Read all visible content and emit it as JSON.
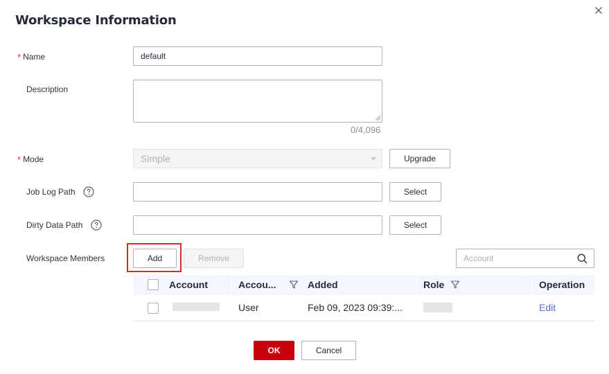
{
  "dialog": {
    "title": "Workspace Information"
  },
  "form": {
    "name_label": "Name",
    "name_value": "default",
    "description_label": "Description",
    "description_counter": "0/4,096",
    "mode_label": "Mode",
    "mode_value": "Simple",
    "upgrade_label": "Upgrade",
    "job_log_path_label": "Job Log Path",
    "dirty_data_path_label": "Dirty Data Path",
    "select_label": "Select",
    "workspace_members_label": "Workspace Members"
  },
  "members": {
    "add_label": "Add",
    "remove_label": "Remove",
    "search_placeholder": "Account",
    "columns": [
      "Account",
      "Accou...",
      "Added",
      "Role",
      "Operation"
    ],
    "rows": [
      {
        "account_type": "User",
        "added": "Feb 09, 2023 09:39:...",
        "operation": "Edit"
      }
    ]
  },
  "footer": {
    "ok_label": "OK",
    "cancel_label": "Cancel"
  },
  "colors": {
    "required": "#e6342d",
    "primary": "#c7000b",
    "link": "#526ecc",
    "highlight": "#d9262c",
    "table_header_bg": "#f3f6fc"
  },
  "icons": [
    "close-icon",
    "help-icon",
    "resize-grip-icon",
    "chevron-down-icon",
    "search-icon",
    "filter-icon"
  ]
}
